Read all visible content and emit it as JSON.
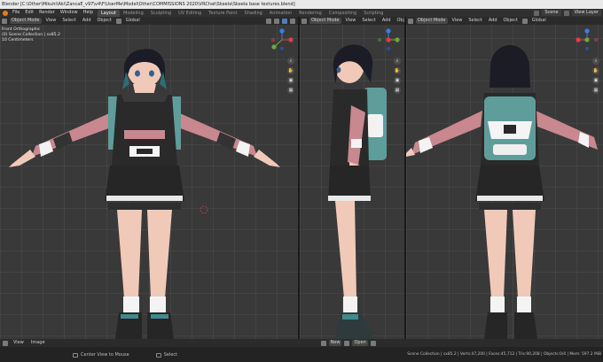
{
  "window": {
    "title": "Blender [C:\\Other\\Mikuhi\\Aki\\ZancaE_v97\\v4\\F\\UserMe\\Model\\Other\\COMMISSIONS 2020\\VRChat\\Skeela\\Skeela base textures.blend]"
  },
  "menu": [
    "File",
    "Edit",
    "Render",
    "Window",
    "Help"
  ],
  "workspaces": [
    {
      "label": "Layout",
      "active": true
    },
    {
      "label": "Modeling",
      "active": false
    },
    {
      "label": "Sculpting",
      "active": false
    },
    {
      "label": "UV Editing",
      "active": false
    },
    {
      "label": "Texture Paint",
      "active": false
    },
    {
      "label": "Shading",
      "active": false
    },
    {
      "label": "Animation",
      "active": false
    },
    {
      "label": "Rendering",
      "active": false
    },
    {
      "label": "Compositing",
      "active": false
    },
    {
      "label": "Scripting",
      "active": false
    }
  ],
  "topright": {
    "scene": "Scene",
    "view_layer": "View Layer"
  },
  "viewport_header": {
    "mode": "Object Mode",
    "view": "View",
    "select": "Select",
    "add": "Add",
    "object": "Object",
    "orientation": "Global"
  },
  "viewport1_info": {
    "view_name": "Front Orthographic",
    "collection": "(0) Scene Collection | sx85.2",
    "units": "10 Centimeters"
  },
  "bottombar": {
    "view": "View",
    "image": "Image",
    "new": "New",
    "open": "Open"
  },
  "statusbar": {
    "center_view": "Center View to Mouse",
    "select": "Select",
    "stats": "Scene Collection | sx85.2 | Verts:47,200 | Faces:45,712 | Tris:90,208 | Objects:0/4 | Mem: 597.2 MiB"
  },
  "colors": {
    "accent": "#e87d0d",
    "viewport_bg": "#393939",
    "active_tab": "#474747",
    "axis_x": "#e03c4d",
    "axis_y": "#6da839",
    "axis_z": "#3a7ee6"
  },
  "icons": [
    "blender-logo-icon",
    "cursor-icon",
    "overlay-icon",
    "shading-solid-icon",
    "zoom-icon",
    "pan-hand-icon",
    "camera-icon",
    "grid-icon"
  ]
}
